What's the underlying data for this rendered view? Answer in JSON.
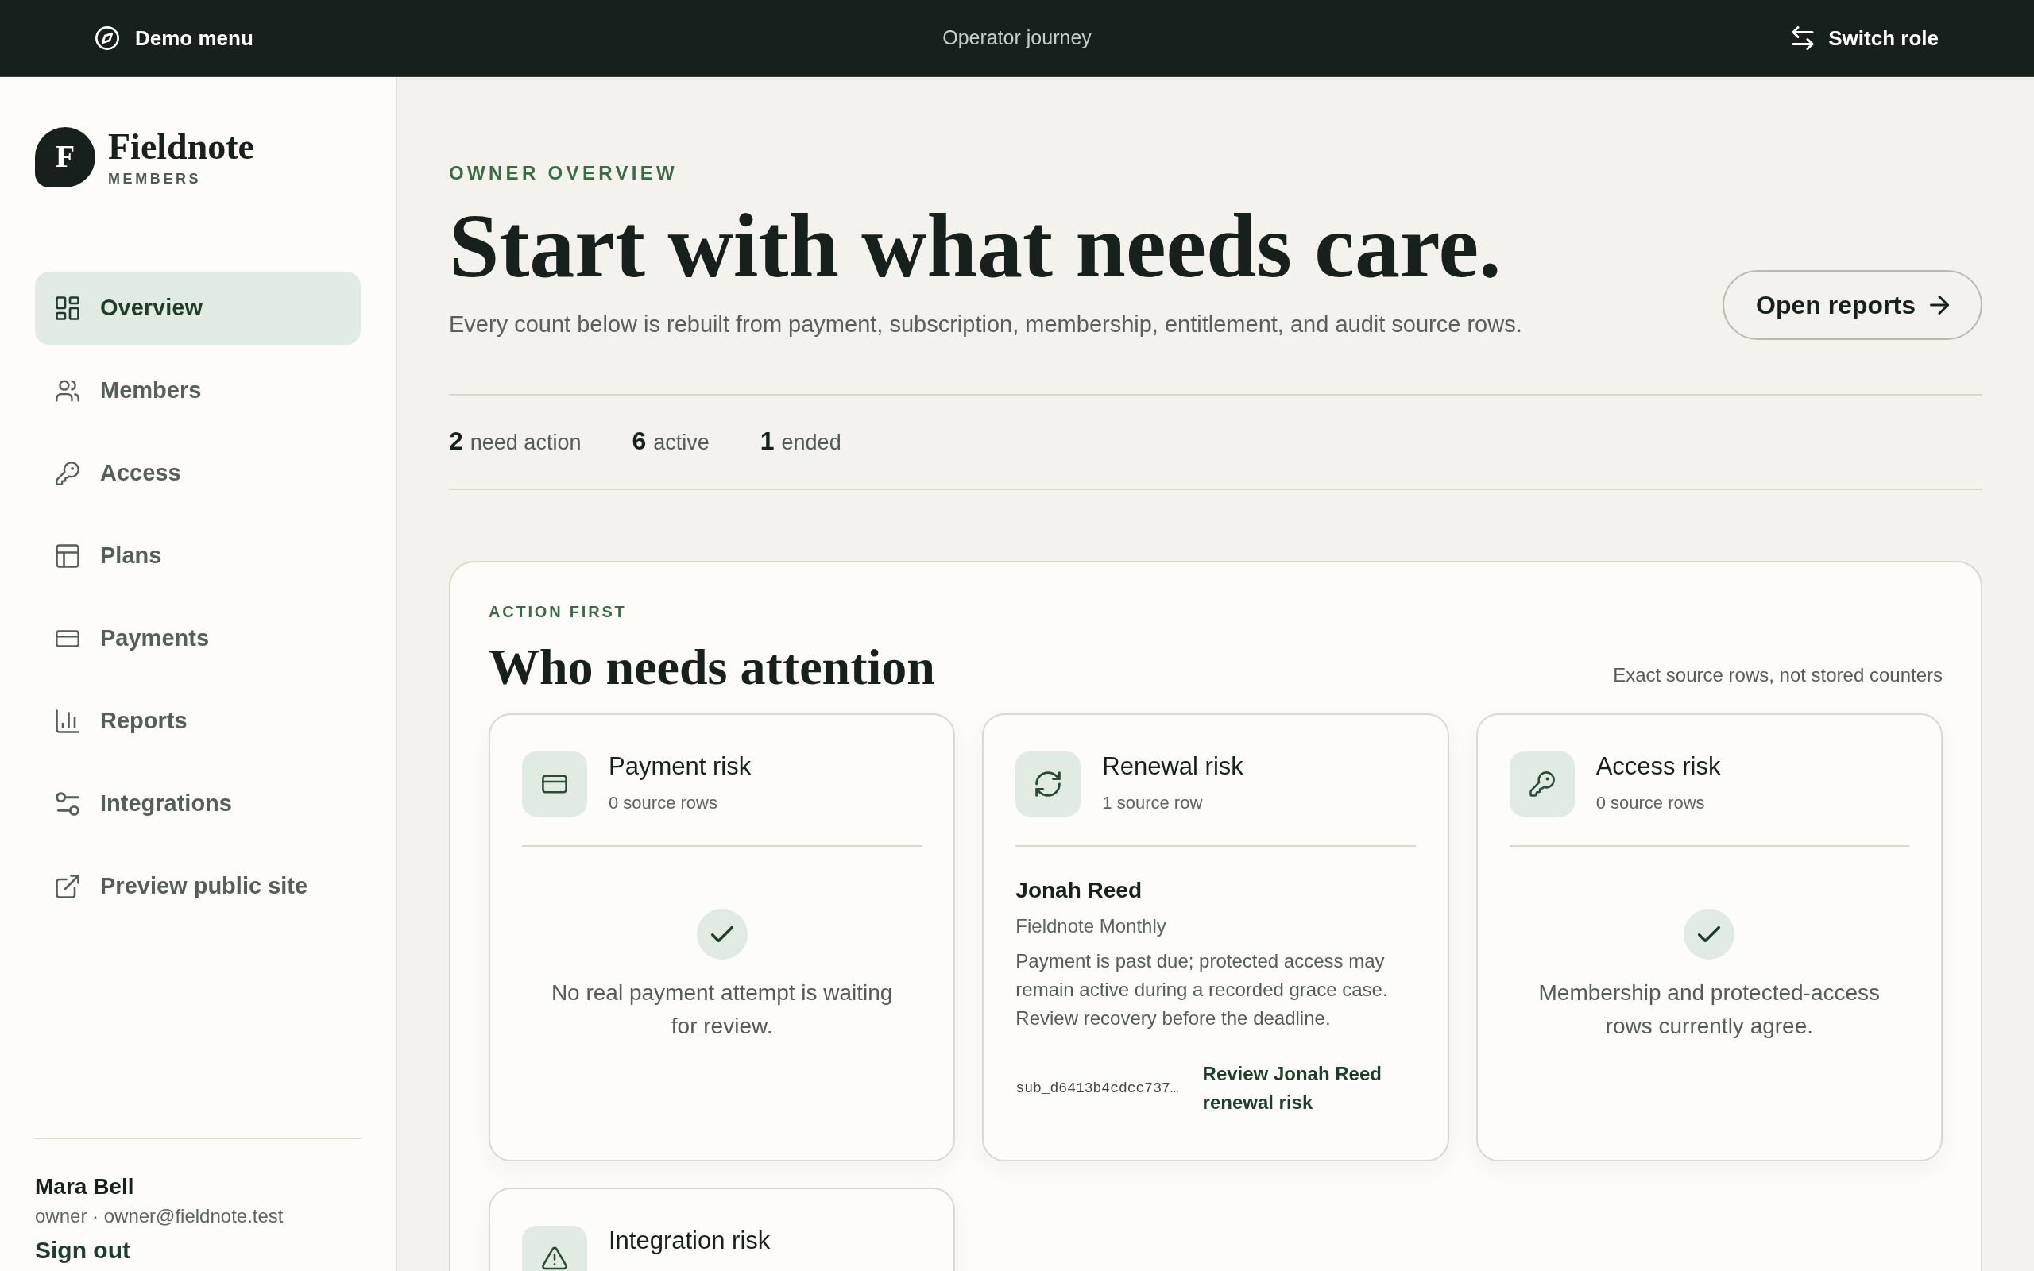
{
  "top_bar": {
    "menu_button": "Demo menu",
    "journey": "Operator journey",
    "switch_button": "Switch role"
  },
  "sidebar": {
    "brand": {
      "monogram": "F",
      "name": "Fieldnote",
      "tagline": "MEMBERS"
    },
    "nav": [
      {
        "label": "Overview",
        "selected": true
      },
      {
        "label": "Members",
        "selected": false
      },
      {
        "label": "Access",
        "selected": false
      },
      {
        "label": "Plans",
        "selected": false
      },
      {
        "label": "Payments",
        "selected": false
      },
      {
        "label": "Reports",
        "selected": false
      },
      {
        "label": "Integrations",
        "selected": false
      },
      {
        "label": "Preview public site",
        "selected": false
      }
    ],
    "user": {
      "name": "Mara Bell",
      "details": "owner · owner@fieldnote.test",
      "sign_out": "Sign out"
    }
  },
  "header": {
    "eyebrow": "OWNER OVERVIEW",
    "title": "Start with what needs care.",
    "subtitle": "Every count below is rebuilt from payment, subscription, membership, entitlement, and audit source rows.",
    "button": "Open reports"
  },
  "stats": [
    {
      "value": "2",
      "label": "need action"
    },
    {
      "value": "6",
      "label": "active"
    },
    {
      "value": "1",
      "label": "ended"
    }
  ],
  "attention": {
    "eyebrow": "ACTION FIRST",
    "title": "Who needs attention",
    "note": "Exact source rows, not stored counters",
    "cards": [
      {
        "kind": "clear",
        "title": "Payment risk",
        "count": "0 source rows",
        "message": "No real payment attempt is waiting for review."
      },
      {
        "kind": "rows",
        "title": "Renewal risk",
        "count": "1 source row",
        "rows": [
          {
            "name": "Jonah Reed",
            "plan": "Fieldnote Monthly",
            "description": "Payment is past due; protected access may remain active during a recorded grace case. Review recovery before the deadline.",
            "reference": "sub_d6413b4cdcc737…",
            "action": "Review Jonah Reed renewal risk"
          }
        ]
      },
      {
        "kind": "clear",
        "title": "Access risk",
        "count": "0 source rows",
        "message": "Membership and protected-access rows currently agree."
      },
      {
        "title": "Integration risk"
      }
    ]
  }
}
